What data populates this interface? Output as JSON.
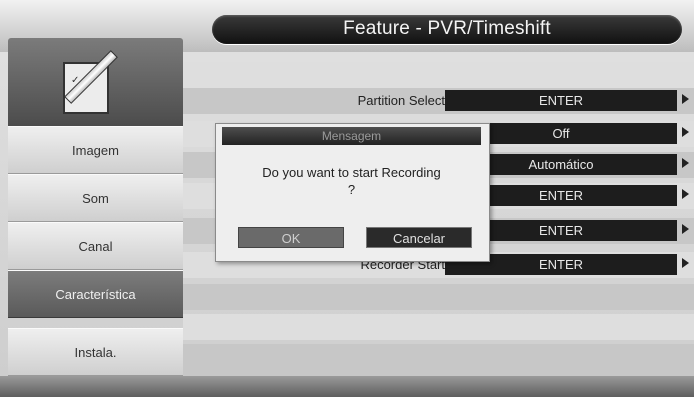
{
  "header": {
    "title": "Feature - PVR/Timeshift"
  },
  "sidebar": {
    "logo_icon": "checklist-pencil-icon",
    "items": [
      {
        "label": "Imagem"
      },
      {
        "label": "Som"
      },
      {
        "label": "Canal"
      },
      {
        "label": "Característica",
        "active": true
      },
      {
        "label": "Instala."
      }
    ]
  },
  "settings": {
    "rows": [
      {
        "label": "Partition Select",
        "value": "ENTER"
      },
      {
        "label": "",
        "value": "Off"
      },
      {
        "label": "",
        "value": "Automático"
      },
      {
        "label": "",
        "value": "ENTER"
      },
      {
        "label": "",
        "value": "ENTER"
      },
      {
        "label": "Recorder Start",
        "value": "ENTER"
      }
    ],
    "arrow_icon": "triangle-right-icon"
  },
  "dialog": {
    "title": "Mensagem",
    "message_line1": "Do you want to start Recording",
    "message_line2": "?",
    "ok_label": "OK",
    "cancel_label": "Cancelar"
  }
}
